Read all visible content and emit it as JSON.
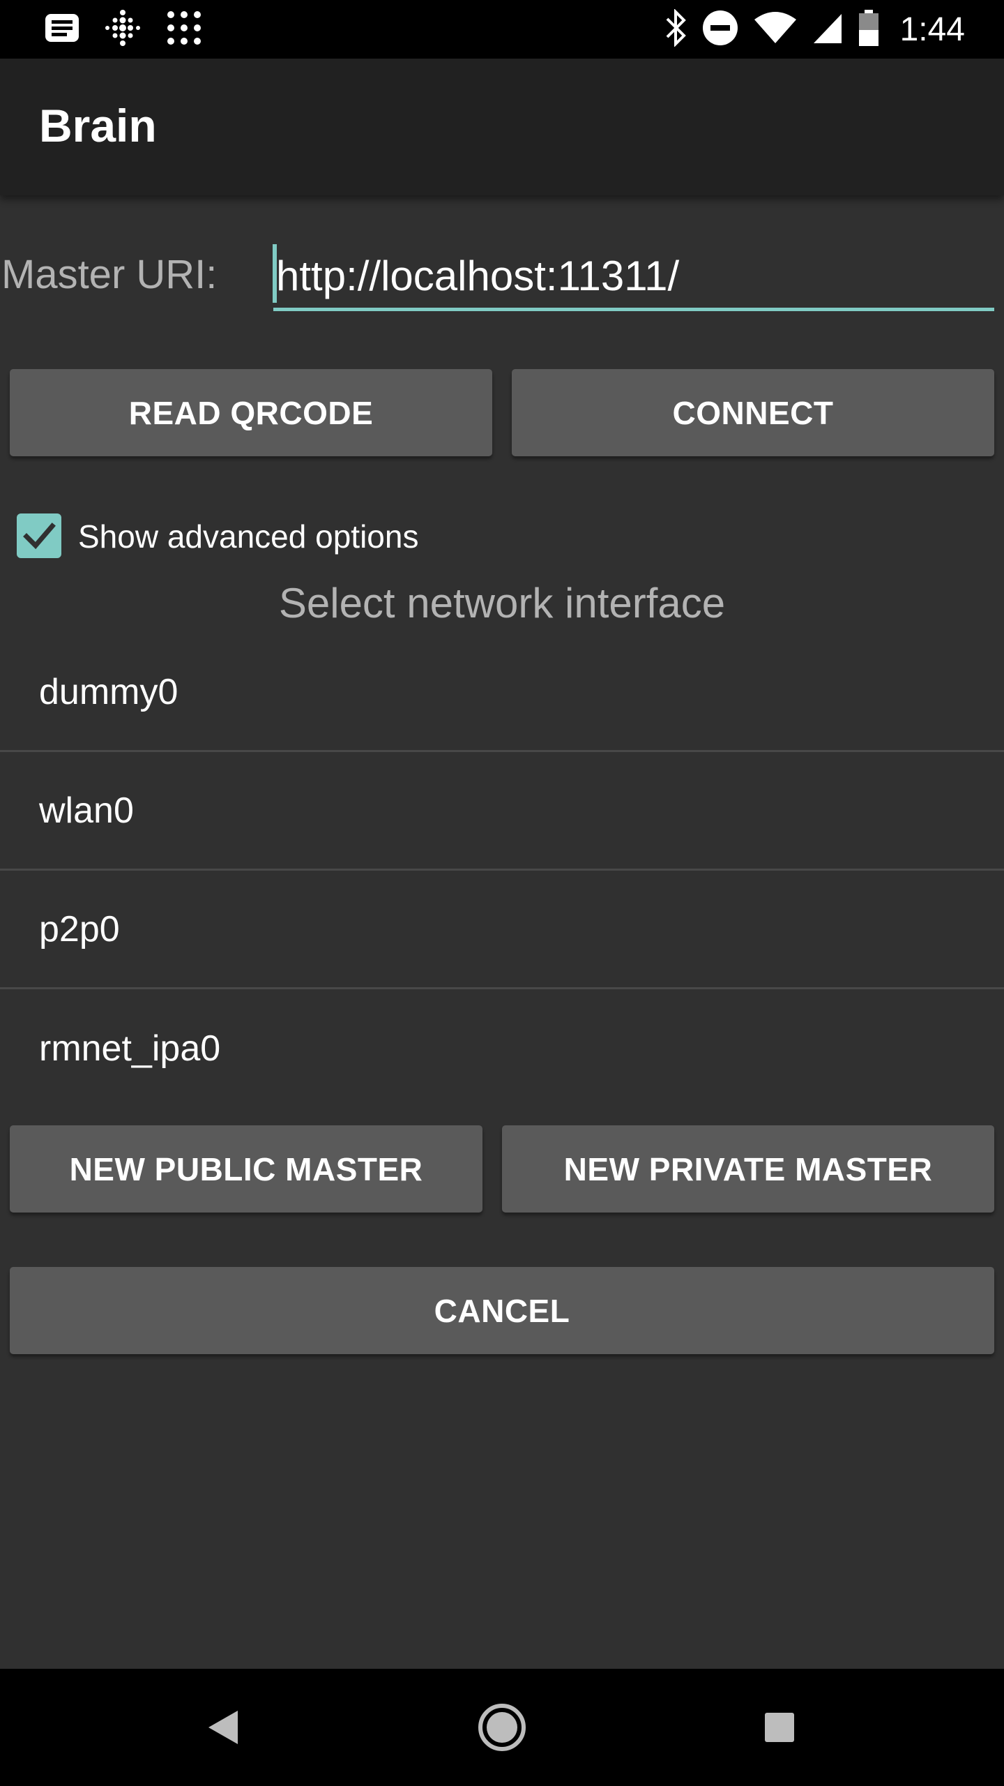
{
  "status_bar": {
    "time": "1:44",
    "left_icons": [
      "message-icon",
      "fitbit-icon",
      "app-grid-icon"
    ],
    "right_icons": [
      "bluetooth-icon",
      "do-not-disturb-icon",
      "wifi-icon",
      "cell-signal-icon",
      "battery-icon"
    ]
  },
  "app_bar": {
    "title": "Brain"
  },
  "master_uri": {
    "label": "Master URI:",
    "value": "http://localhost:11311/"
  },
  "buttons": {
    "read_qrcode": "READ QRCODE",
    "connect": "CONNECT",
    "new_public_master": "NEW PUBLIC MASTER",
    "new_private_master": "NEW PRIVATE MASTER",
    "cancel": "CANCEL"
  },
  "advanced": {
    "label": "Show advanced options",
    "checked": true
  },
  "network": {
    "title": "Select network interface",
    "interfaces": [
      "dummy0",
      "wlan0",
      "p2p0",
      "rmnet_ipa0"
    ]
  },
  "nav_bar": {
    "icons": [
      "back-icon",
      "home-icon",
      "recents-icon"
    ]
  },
  "colors": {
    "accent": "#80cbc4",
    "background": "#303030",
    "app_bar": "#212121",
    "button": "#5a5a5a"
  }
}
